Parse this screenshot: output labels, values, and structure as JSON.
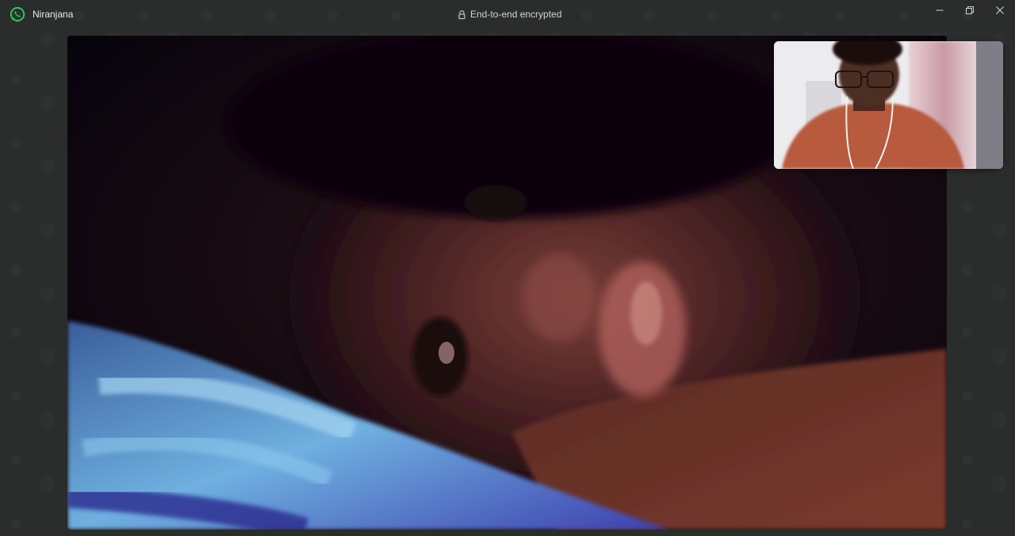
{
  "titlebar": {
    "app_icon": "whatsapp-logo-icon",
    "contact_name": "Niranjana",
    "encryption_icon": "lock-icon",
    "encryption_text": "End-to-end encrypted",
    "controls": {
      "minimize_icon": "minimize-icon",
      "restore_icon": "restore-icon",
      "close_icon": "close-icon"
    }
  },
  "call": {
    "remote_video": "remote-participant-video",
    "local_video": "self-preview-video"
  },
  "colors": {
    "brand": "#25d366",
    "background": "#2b2c2c",
    "text": "#e9edef"
  }
}
